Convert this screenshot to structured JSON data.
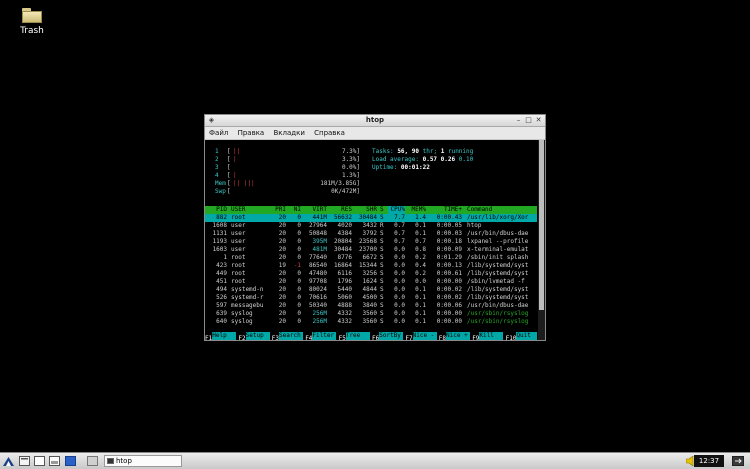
{
  "desktop": {
    "trash_label": "Trash"
  },
  "window": {
    "title": "htop",
    "menu": [
      "Файл",
      "Правка",
      "Вкладки",
      "Справка"
    ]
  },
  "meters": {
    "cpu": [
      {
        "label": "1",
        "fill": "||",
        "pct": "7.3%]"
      },
      {
        "label": "2",
        "fill": "|",
        "pct": "3.3%]"
      },
      {
        "label": "3",
        "fill": "",
        "pct": "0.0%]"
      },
      {
        "label": "4",
        "fill": "|",
        "pct": "1.3%]"
      }
    ],
    "mem": {
      "label": "Mem",
      "fill": "|| |||",
      "pct": "181M/3.85G]"
    },
    "swp": {
      "label": "Swp",
      "fill": "",
      "pct": "0K/472M]"
    }
  },
  "summary": {
    "tasks_label": "Tasks:",
    "tasks": "56,",
    "thr": "90",
    "thr_label": "thr;",
    "running": "1",
    "running_label": "running",
    "load_label": "Load average:",
    "load1": "0.57",
    "load5": "0.26",
    "load15": "0.10",
    "uptime_label": "Uptime:",
    "uptime": "00:01:22"
  },
  "columns": [
    "PID",
    "USER",
    "PRI",
    "NI",
    "VIRT",
    "RES",
    "SHR",
    "S",
    "CPU%",
    "MEM%",
    "TIME+",
    "Command"
  ],
  "processes": [
    [
      "882",
      "root",
      "20",
      "0",
      "441M",
      "56632",
      "30484",
      "S",
      "7.7",
      "1.4",
      "0:00.43",
      "/usr/lib/xorg/Xor"
    ],
    [
      "1608",
      "user",
      "20",
      "0",
      "27964",
      "4020",
      "3432",
      "R",
      "0.7",
      "0.1",
      "0:00.05",
      "htop"
    ],
    [
      "1131",
      "user",
      "20",
      "0",
      "50848",
      "4384",
      "3792",
      "S",
      "0.7",
      "0.1",
      "0:00.03",
      "/usr/bin/dbus-dae"
    ],
    [
      "1193",
      "user",
      "20",
      "0",
      "395M",
      "20804",
      "23568",
      "S",
      "0.7",
      "0.7",
      "0:00.18",
      "lxpanel --profile"
    ],
    [
      "1603",
      "user",
      "20",
      "0",
      "481M",
      "30484",
      "23700",
      "S",
      "0.0",
      "0.8",
      "0:00.09",
      "x-terminal-emulat"
    ],
    [
      "1",
      "root",
      "20",
      "0",
      "77640",
      "8776",
      "6672",
      "S",
      "0.0",
      "0.2",
      "0:01.29",
      "/sbin/init splash"
    ],
    [
      "423",
      "root",
      "19",
      "-1",
      "86540",
      "16864",
      "15344",
      "S",
      "0.0",
      "0.4",
      "0:00.13",
      "/lib/systemd/syst"
    ],
    [
      "449",
      "root",
      "20",
      "0",
      "47480",
      "6116",
      "3256",
      "S",
      "0.0",
      "0.2",
      "0:00.61",
      "/lib/systemd/syst"
    ],
    [
      "451",
      "root",
      "20",
      "0",
      "97708",
      "1796",
      "1624",
      "S",
      "0.0",
      "0.0",
      "0:00.00",
      "/sbin/lvmetad -f"
    ],
    [
      "494",
      "systemd-n",
      "20",
      "0",
      "80024",
      "5440",
      "4844",
      "S",
      "0.0",
      "0.1",
      "0:00.02",
      "/lib/systemd/syst"
    ],
    [
      "526",
      "systemd-r",
      "20",
      "0",
      "70616",
      "5060",
      "4500",
      "S",
      "0.0",
      "0.1",
      "0:00.02",
      "/lib/systemd/syst"
    ],
    [
      "597",
      "messagebu",
      "20",
      "0",
      "50340",
      "4888",
      "3840",
      "S",
      "0.0",
      "0.1",
      "0:00.06",
      "/usr/bin/dbus-dae"
    ],
    [
      "639",
      "syslog",
      "20",
      "0",
      "256M",
      "4332",
      "3560",
      "S",
      "0.0",
      "0.1",
      "0:00.00",
      "/usr/sbin/rsyslog"
    ],
    [
      "640",
      "syslog",
      "20",
      "0",
      "256M",
      "4332",
      "3560",
      "S",
      "0.0",
      "0.1",
      "0:00.00",
      "/usr/sbin/rsyslog"
    ]
  ],
  "fkeys": [
    {
      "k": "F1",
      "l": "Help"
    },
    {
      "k": "F2",
      "l": "Setup"
    },
    {
      "k": "F3",
      "l": "Search"
    },
    {
      "k": "F4",
      "l": "Filter"
    },
    {
      "k": "F5",
      "l": "Tree"
    },
    {
      "k": "F6",
      "l": "SortBy"
    },
    {
      "k": "F7",
      "l": "Nice -"
    },
    {
      "k": "F8",
      "l": "Nice +"
    },
    {
      "k": "F9",
      "l": "Kill"
    },
    {
      "k": "F10",
      "l": "Quit"
    }
  ],
  "taskbar": {
    "task_label": "htop",
    "clock": "12:37"
  },
  "colors": {
    "header_bg": "#22a822",
    "selected_bg": "#00a8a8",
    "accent_cyan": "#3cc8c8"
  }
}
